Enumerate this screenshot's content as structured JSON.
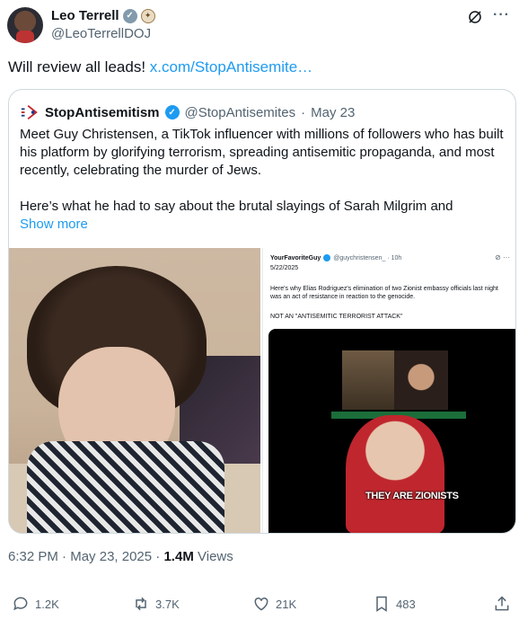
{
  "author": {
    "name": "Leo Terrell",
    "handle": "@LeoTerrellDOJ"
  },
  "tweet": {
    "text": "Will review all leads!",
    "link": "x.com/StopAntisemite…"
  },
  "quote": {
    "name": "StopAntisemitism",
    "handle": "@StopAntisemites",
    "separator": "·",
    "date": "May 23",
    "paragraph1": "Meet Guy Christensen, a TikTok influencer with millions of followers who has built his platform by glorifying terrorism, spreading antisemitic propaganda, and most recently, celebrating the murder of Jews.",
    "paragraph2": "Here’s what he had to say about the brutal slayings of Sarah Milgrim and",
    "show_more": "Show more"
  },
  "embedded": {
    "name": "YourFavoriteGuy",
    "handle": "@guychristensen_ · 10h",
    "date": "5/22/2025",
    "text": "Here's why Elias Rodriguez's elimination of two Zionist embassy officials last night was an act of resistance in reaction to the genocide.",
    "caps_text": "NOT AN \"ANTISEMITIC TERRORIST ATTACK\"",
    "video_caption": "THEY ARE ZIONISTS"
  },
  "meta": {
    "time": "6:32 PM",
    "separator": "·",
    "date": "May 23, 2025",
    "views_count": "1.4M",
    "views_label": "Views"
  },
  "actions": {
    "replies": "1.2K",
    "reposts": "3.7K",
    "likes": "21K",
    "bookmarks": "483"
  },
  "icons": [
    "verified-icon",
    "seal-icon",
    "grok-icon",
    "more-icon",
    "reply-icon",
    "repost-icon",
    "like-icon",
    "bookmark-icon",
    "share-icon"
  ],
  "colors": {
    "link": "#1d9bf0",
    "secondary_text": "#536471",
    "border": "#cfd9de"
  }
}
